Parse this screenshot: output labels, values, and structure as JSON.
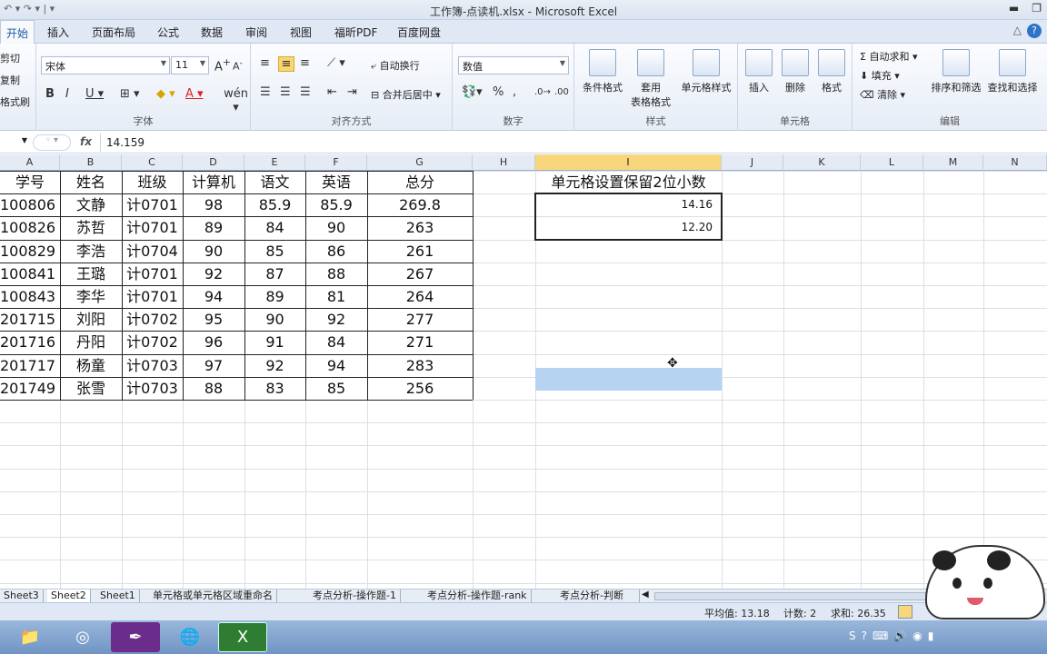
{
  "window": {
    "title": "工作簿-点读机.xlsx  -  Microsoft Excel"
  },
  "tabs": [
    "开始",
    "插入",
    "页面布局",
    "公式",
    "数据",
    "审阅",
    "视图",
    "福昕PDF",
    "百度网盘"
  ],
  "clipboard": {
    "cut": "剪切",
    "copy": "复制",
    "painter": "格式刷"
  },
  "font": {
    "name": "宋体",
    "size": "11",
    "group": "字体"
  },
  "align": {
    "wrap": "自动换行",
    "merge": "合并后居中",
    "group": "对齐方式"
  },
  "number": {
    "format": "数值",
    "group": "数字"
  },
  "styles": {
    "cond": "条件格式",
    "table1": "套用",
    "table2": "表格格式",
    "cellstyle": "单元格样式",
    "group": "样式"
  },
  "cells": {
    "insert": "插入",
    "delete": "删除",
    "format": "格式",
    "group": "单元格"
  },
  "editing": {
    "autosum": "自动求和",
    "fill": "填充",
    "clear": "清除",
    "sort": "排序和筛选",
    "find": "查找和选择",
    "group": "编辑"
  },
  "formula_bar": {
    "fx": "fx",
    "value": "14.159"
  },
  "columns": [
    "A",
    "B",
    "C",
    "D",
    "E",
    "F",
    "G",
    "H",
    "I",
    "J",
    "K",
    "L",
    "M",
    "N"
  ],
  "selected_column": "I",
  "table": {
    "headers": [
      "学号",
      "姓名",
      "班级",
      "计算机",
      "语文",
      "英语",
      "总分"
    ],
    "rows": [
      [
        "100806",
        "文静",
        "计0701",
        "98",
        "85.9",
        "85.9",
        "269.8"
      ],
      [
        "100826",
        "苏哲",
        "计0701",
        "89",
        "84",
        "90",
        "263"
      ],
      [
        "100829",
        "李浩",
        "计0704",
        "90",
        "85",
        "86",
        "261"
      ],
      [
        "100841",
        "王璐",
        "计0701",
        "92",
        "87",
        "88",
        "267"
      ],
      [
        "100843",
        "李华",
        "计0701",
        "94",
        "89",
        "81",
        "264"
      ],
      [
        "201715",
        "刘阳",
        "计0702",
        "95",
        "90",
        "92",
        "277"
      ],
      [
        "201716",
        "丹阳",
        "计0702",
        "96",
        "91",
        "84",
        "271"
      ],
      [
        "201717",
        "杨童",
        "计0703",
        "97",
        "92",
        "94",
        "283"
      ],
      [
        "201749",
        "张雪",
        "计0703",
        "88",
        "83",
        "85",
        "256"
      ]
    ]
  },
  "side_table": {
    "header": "单元格设置保留2位小数",
    "values": [
      "14.16",
      "12.20"
    ]
  },
  "sheets": [
    "Sheet3",
    "Sheet2",
    "Sheet1",
    "单元格或单元格区域重命名",
    "考点分析-操作题-1",
    "考点分析-操作题-rank",
    "考点分析-判断"
  ],
  "active_sheet": "Sheet2",
  "status": {
    "average": "平均值: 13.18",
    "count": "计数: 2",
    "sum": "求和: 26.35"
  },
  "colors": {
    "accent": "#1f5aa8",
    "selection": "#b6d3f2",
    "selected_header": "#f8d67b"
  }
}
